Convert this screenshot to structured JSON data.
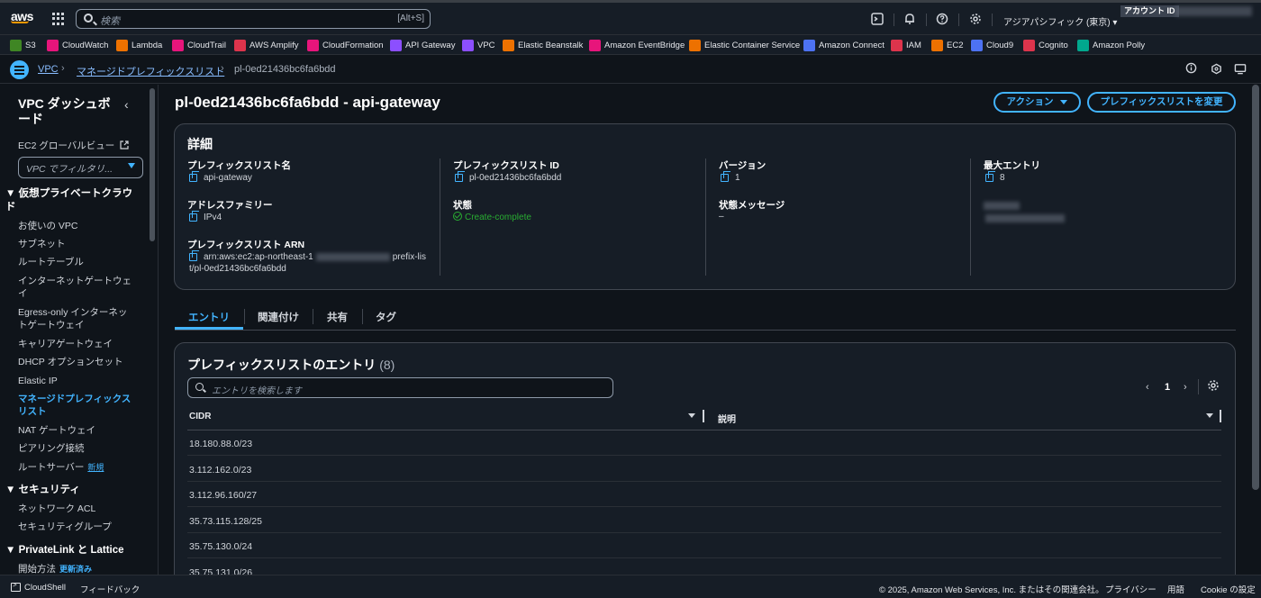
{
  "topbar": {
    "search_placeholder": "検索",
    "search_shortcut": "[Alt+S]",
    "region": "アジアパシフィック (東京) ▾",
    "account_label": "アカウント ID"
  },
  "favorites": [
    {
      "label": "S3",
      "color": "#3f8624"
    },
    {
      "label": "CloudWatch",
      "color": "#e7157b"
    },
    {
      "label": "Lambda",
      "color": "#ed7100"
    },
    {
      "label": "CloudTrail",
      "color": "#e7157b"
    },
    {
      "label": "AWS Amplify",
      "color": "#dd344c"
    },
    {
      "label": "CloudFormation",
      "color": "#e7157b"
    },
    {
      "label": "API Gateway",
      "color": "#8c4fff"
    },
    {
      "label": "VPC",
      "color": "#8c4fff"
    },
    {
      "label": "Elastic Beanstalk",
      "color": "#ed7100"
    },
    {
      "label": "Amazon EventBridge",
      "color": "#e7157b"
    },
    {
      "label": "Elastic Container Service",
      "color": "#ed7100"
    },
    {
      "label": "Amazon Connect",
      "color": "#4d72f3"
    },
    {
      "label": "IAM",
      "color": "#dd344c"
    },
    {
      "label": "EC2",
      "color": "#ed7100"
    },
    {
      "label": "Cloud9",
      "color": "#4d72f3"
    },
    {
      "label": "Cognito",
      "color": "#dd344c"
    },
    {
      "label": "Amazon Polly",
      "color": "#01a88d"
    }
  ],
  "breadcrumb": {
    "vpc": "VPC",
    "managed_prefix_lists": "マネージドプレフィックスリスト",
    "current": "pl-0ed21436bc6fa6bdd"
  },
  "sidebar": {
    "title": "VPC ダッシュボード",
    "ec2_global_view": "EC2 グローバルビュー",
    "filter_placeholder": "VPC でフィルタリ...",
    "section_vpc": "▼ 仮想プライベートクラウド",
    "items_vpc": [
      "お使いの VPC",
      "サブネット",
      "ルートテーブル",
      "インターネットゲートウェイ",
      "Egress-only インターネットゲートウェイ",
      "キャリアゲートウェイ",
      "DHCP オプションセット",
      "Elastic IP",
      "マネージドプレフィックスリスト",
      "NAT ゲートウェイ",
      "ピアリング接続",
      "ルートサーバー"
    ],
    "new_badge": "新規",
    "section_security": "▼ セキュリティ",
    "items_security": [
      "ネットワーク ACL",
      "セキュリティグループ"
    ],
    "section_privatelink": "▼ PrivateLink と Lattice",
    "items_privatelink": [
      "開始方法"
    ],
    "updated_badge": "更新済み"
  },
  "page": {
    "title": "pl-0ed21436bc6fa6bdd - api-gateway",
    "actions_button": "アクション",
    "modify_button": "プレフィックスリストを変更"
  },
  "details": {
    "title": "詳細",
    "name_label": "プレフィックスリスト名",
    "name_value": "api-gateway",
    "family_label": "アドレスファミリー",
    "family_value": "IPv4",
    "arn_label": "プレフィックスリスト ARN",
    "arn_value_prefix": "arn:aws:ec2:ap-northeast-1",
    "arn_value_suffix": "prefix-lis",
    "arn_value_line2": "t/pl-0ed21436bc6fa6bdd",
    "id_label": "プレフィックスリスト ID",
    "id_value": "pl-0ed21436bc6fa6bdd",
    "state_label": "状態",
    "state_value": "Create-complete",
    "version_label": "バージョン",
    "version_value": "1",
    "state_msg_label": "状態メッセージ",
    "state_msg_value": "–",
    "max_entries_label": "最大エントリ",
    "max_entries_value": "8"
  },
  "tabs": [
    "エントリ",
    "関連付け",
    "共有",
    "タグ"
  ],
  "entries": {
    "title": "プレフィックスリストのエントリ",
    "count": "(8)",
    "search_placeholder": "エントリを検索します",
    "page_number": "1",
    "col_cidr": "CIDR",
    "col_description": "説明",
    "rows": [
      "18.180.88.0/23",
      "3.112.162.0/23",
      "3.112.96.160/27",
      "35.73.115.128/25",
      "35.75.130.0/24",
      "35.75.131.0/26"
    ]
  },
  "footer": {
    "cloudshell": "CloudShell",
    "feedback": "フィードバック",
    "copyright": "© 2025, Amazon Web Services, Inc. またはその関連会社。",
    "privacy": "プライバシー",
    "terms": "用語",
    "cookies": "Cookie の設定"
  }
}
